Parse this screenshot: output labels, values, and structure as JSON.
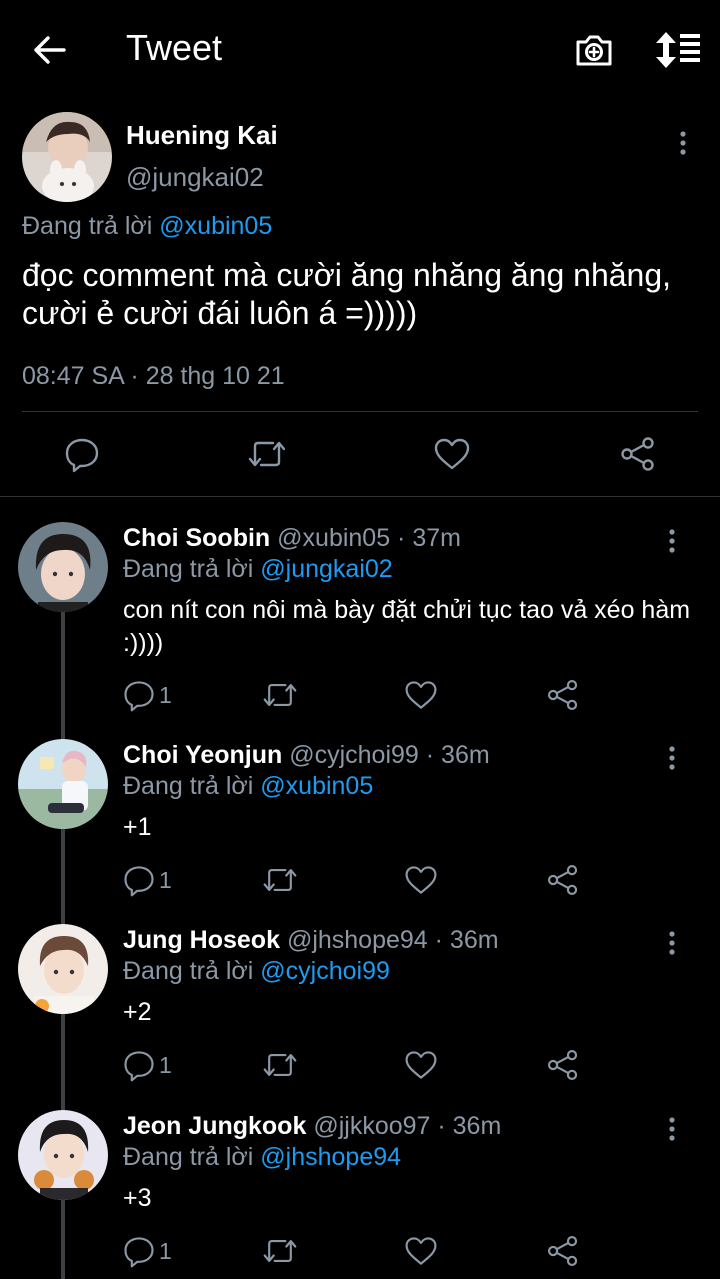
{
  "header": {
    "title": "Tweet"
  },
  "main_tweet": {
    "name": "Huening Kai",
    "handle": "@jungkai02",
    "reply_prefix": "Đang trả lời ",
    "reply_mention": "@xubin05",
    "text": "đọc comment mà cười ăng nhăng ăng nhăng, cười ẻ cười đái luôn á =)))))",
    "timestamp": "08:47 SA · 28 thg 10 21"
  },
  "replies": [
    {
      "name": "Choi Soobin",
      "handle_time": "@xubin05 · 37m",
      "reply_prefix": "Đang trả lời ",
      "reply_mention": "@jungkai02",
      "text": "con nít con nôi mà bày đặt chửi tục tao vả xéo hàm :))))",
      "reply_count": "1"
    },
    {
      "name": "Choi Yeonjun",
      "handle_time": "@cyjchoi99 · 36m",
      "reply_prefix": "Đang trả lời ",
      "reply_mention": "@xubin05",
      "text": "+1",
      "reply_count": "1"
    },
    {
      "name": "Jung Hoseok",
      "handle_time": "@jhshope94 · 36m",
      "reply_prefix": "Đang trả lời ",
      "reply_mention": "@cyjchoi99",
      "text": "+2",
      "reply_count": "1"
    },
    {
      "name": "Jeon Jungkook",
      "handle_time": "@jjkkoo97 · 36m",
      "reply_prefix": "Đang trả lời ",
      "reply_mention": "@jhshope94",
      "text": "+3",
      "reply_count": "1"
    }
  ],
  "icons": {
    "back": "arrow-left-icon",
    "camera": "camera-plus-icon",
    "sort": "sort-icon",
    "reply": "comment-icon",
    "retweet": "retweet-icon",
    "like": "heart-icon",
    "share": "share-icon",
    "more": "more-vertical-icon"
  },
  "colors": {
    "background": "#000000",
    "text": "#ffffff",
    "secondary": "#8b98a5",
    "mention": "#1d9bf0",
    "divider": "#2f3336"
  }
}
